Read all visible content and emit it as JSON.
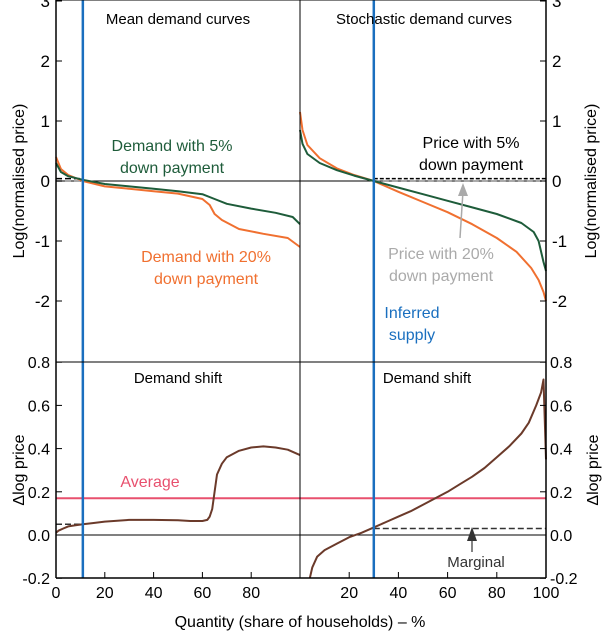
{
  "colors": {
    "green": "#1e5c3a",
    "orange": "#f07030",
    "blue": "#1a6fbf",
    "pink": "#e8506e",
    "brown": "#6b3a2a",
    "grey": "#aaaaaa",
    "dark": "#333333"
  },
  "chart_data": [
    {
      "panel": "top-left",
      "type": "line",
      "title": "Mean demand curves",
      "ylabel": "Log(normalised price)",
      "ylim": [
        -3,
        3
      ],
      "yticks": [
        "3",
        "2",
        "1",
        "0",
        "-1",
        "-2"
      ],
      "xlim": [
        0,
        100
      ],
      "series": [
        {
          "name": "Demand with 5% down payment",
          "x": [
            0,
            2,
            5,
            11,
            20,
            30,
            40,
            50,
            60,
            65,
            70,
            80,
            90,
            97,
            100
          ],
          "y": [
            0.3,
            0.15,
            0.08,
            0.02,
            -0.05,
            -0.09,
            -0.13,
            -0.17,
            -0.22,
            -0.3,
            -0.38,
            -0.46,
            -0.53,
            -0.6,
            -0.72
          ]
        },
        {
          "name": "Demand with 20% down payment",
          "x": [
            0,
            2,
            5,
            11,
            20,
            30,
            40,
            50,
            60,
            63,
            65,
            68,
            75,
            85,
            95,
            100
          ],
          "y": [
            0.4,
            0.2,
            0.1,
            0,
            -0.09,
            -0.13,
            -0.17,
            -0.21,
            -0.3,
            -0.4,
            -0.55,
            -0.65,
            -0.8,
            -0.88,
            -0.95,
            -1.1
          ]
        }
      ],
      "supply_x": 11,
      "marginal_price_5": 0.04,
      "marginal_price_20": 0.0,
      "annotations": [
        {
          "text": [
            "Demand with 5%",
            "down payment"
          ],
          "color": "green"
        },
        {
          "text": [
            "Demand with 20%",
            "down payment"
          ],
          "color": "orange"
        }
      ]
    },
    {
      "panel": "top-right",
      "type": "line",
      "title": "Stochastic demand curves",
      "ylabel": "Log(normalised price)",
      "ylim": [
        -3,
        3
      ],
      "yticks": [
        "3",
        "2",
        "1",
        "0",
        "-1",
        "-2"
      ],
      "xlim": [
        0,
        100
      ],
      "series": [
        {
          "name": "Demand with 5% down payment",
          "x": [
            0,
            1,
            3,
            8,
            15,
            22,
            30,
            40,
            50,
            60,
            70,
            80,
            90,
            95,
            97,
            99,
            100
          ],
          "y": [
            0.85,
            0.62,
            0.45,
            0.3,
            0.18,
            0.09,
            0.0,
            -0.11,
            -0.22,
            -0.33,
            -0.44,
            -0.55,
            -0.7,
            -0.85,
            -1.0,
            -1.35,
            -1.5
          ]
        },
        {
          "name": "Demand with 20% down payment",
          "x": [
            0,
            1,
            3,
            8,
            15,
            22,
            30,
            40,
            50,
            60,
            70,
            80,
            88,
            94,
            97,
            99,
            100
          ],
          "y": [
            1.15,
            0.85,
            0.6,
            0.38,
            0.21,
            0.1,
            0.0,
            -0.18,
            -0.35,
            -0.52,
            -0.72,
            -0.95,
            -1.18,
            -1.45,
            -1.65,
            -1.85,
            -2.0
          ]
        }
      ],
      "supply_x": 30,
      "marginal_price_5": 0.04,
      "marginal_price_20": 0.0,
      "annotations": [
        {
          "text": [
            "Price with 5%",
            "down payment"
          ],
          "color": "black"
        },
        {
          "text": [
            "Price with 20%",
            "down payment"
          ],
          "color": "grey"
        },
        {
          "text": [
            "Inferred",
            "supply"
          ],
          "color": "blue"
        }
      ]
    },
    {
      "panel": "bottom-left",
      "type": "line",
      "title": "Demand shift",
      "ylabel": "Δlog price",
      "ylim": [
        -0.2,
        0.8
      ],
      "yticks": [
        "0.8",
        "0.6",
        "0.4",
        "0.2",
        "0.0",
        "-0.2"
      ],
      "xlim": [
        0,
        100
      ],
      "xticks": [
        "0",
        "20",
        "40",
        "60",
        "80"
      ],
      "series": [
        {
          "name": "Demand shift",
          "x": [
            0,
            1,
            3,
            5,
            8,
            11,
            15,
            20,
            30,
            40,
            50,
            55,
            60,
            62,
            63,
            64,
            65,
            66,
            68,
            70,
            75,
            80,
            85,
            90,
            95,
            100
          ],
          "y": [
            0.01,
            0.02,
            0.03,
            0.04,
            0.045,
            0.05,
            0.055,
            0.062,
            0.07,
            0.07,
            0.068,
            0.065,
            0.065,
            0.07,
            0.085,
            0.12,
            0.2,
            0.28,
            0.33,
            0.36,
            0.39,
            0.405,
            0.41,
            0.405,
            0.395,
            0.37
          ]
        }
      ],
      "average": 0.17,
      "marginal": 0.05,
      "supply_x": 11,
      "annotations": [
        {
          "text": "Average",
          "color": "pink"
        }
      ]
    },
    {
      "panel": "bottom-right",
      "type": "line",
      "title": "Demand shift",
      "ylabel": "Δlog price",
      "ylim": [
        -0.2,
        0.8
      ],
      "yticks": [
        "0.8",
        "0.6",
        "0.4",
        "0.2",
        "0.0",
        "-0.2"
      ],
      "xlim": [
        0,
        100
      ],
      "xticks": [
        "20",
        "40",
        "60",
        "80",
        "100"
      ],
      "series": [
        {
          "name": "Demand shift",
          "x": [
            4,
            5,
            7,
            10,
            15,
            20,
            25,
            30,
            35,
            40,
            45,
            50,
            55,
            60,
            65,
            70,
            75,
            80,
            85,
            90,
            93,
            96,
            98,
            99,
            100
          ],
          "y": [
            -0.2,
            -0.15,
            -0.1,
            -0.07,
            -0.04,
            -0.01,
            0.01,
            0.035,
            0.06,
            0.085,
            0.11,
            0.14,
            0.17,
            0.2,
            0.235,
            0.27,
            0.31,
            0.36,
            0.41,
            0.47,
            0.52,
            0.6,
            0.66,
            0.72,
            0.35
          ]
        }
      ],
      "average": 0.17,
      "marginal": 0.03,
      "supply_x": 30,
      "annotations": [
        {
          "text": "Marginal",
          "color": "dark"
        }
      ]
    }
  ],
  "xlabel": "Quantity (share of households) – %"
}
